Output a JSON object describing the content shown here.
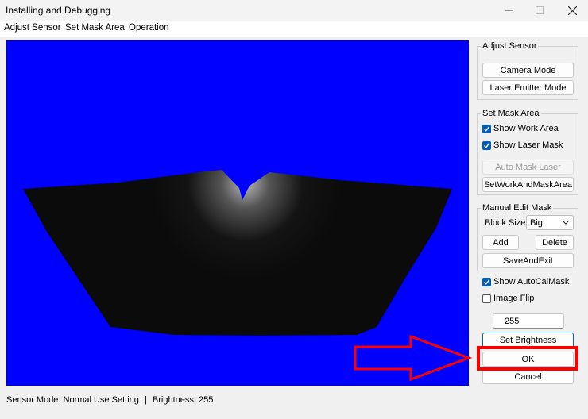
{
  "window": {
    "title": "Installing and Debugging"
  },
  "menu": [
    "Adjust Sensor",
    "Set Mask Area",
    "Operation"
  ],
  "adjust_sensor": {
    "label": "Adjust Sensor",
    "camera_mode": "Camera Mode",
    "laser_emitter_mode": "Laser Emitter Mode"
  },
  "mask_area": {
    "label": "Set Mask Area",
    "show_work_area": "Show Work Area",
    "show_laser_mask": "Show Laser Mask",
    "auto_mask_laser": "Auto Mask Laser",
    "set_work_and_mask": "SetWorkAndMaskArea"
  },
  "manual_edit": {
    "label": "Manual Edit Mask",
    "block_size_label": "Block Size:",
    "block_size_value": "Big",
    "add": "Add",
    "delete": "Delete",
    "save_and_exit": "SaveAndExit"
  },
  "options": {
    "show_autocal_mask": "Show AutoCalMask",
    "image_flip": "Image Flip"
  },
  "brightness": {
    "value": "255",
    "set_label": "Set Brightness"
  },
  "actions": {
    "ok": "OK",
    "cancel": "Cancel"
  },
  "status": {
    "mode_label": "Sensor Mode: Normal Use Setting",
    "separator": "|",
    "brightness_label": "Brightness: 255"
  },
  "colors": {
    "canvas_bg": "#0000ff",
    "checkbox_accent": "#005fb8",
    "annotation_red": "#ff0000"
  }
}
